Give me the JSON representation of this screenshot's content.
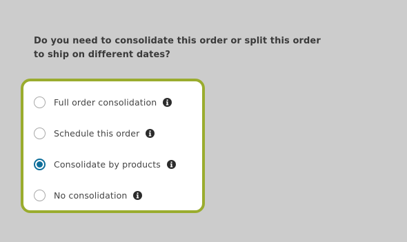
{
  "question": {
    "line1": "Do you need to consolidate this order or split this order",
    "line2": "to ship on different dates?"
  },
  "options": [
    {
      "label": "Full order consolidation",
      "checked": false,
      "icon": "info-icon"
    },
    {
      "label": "Schedule this order",
      "checked": false,
      "icon": "info-icon"
    },
    {
      "label": "Consolidate by products",
      "checked": true,
      "icon": "info-icon"
    },
    {
      "label": "No consolidation",
      "checked": false,
      "icon": "info-icon"
    }
  ],
  "colors": {
    "background": "#cccccc",
    "card_border": "#9aac2e",
    "radio_selected": "#0f6f9b",
    "text": "#444444"
  }
}
